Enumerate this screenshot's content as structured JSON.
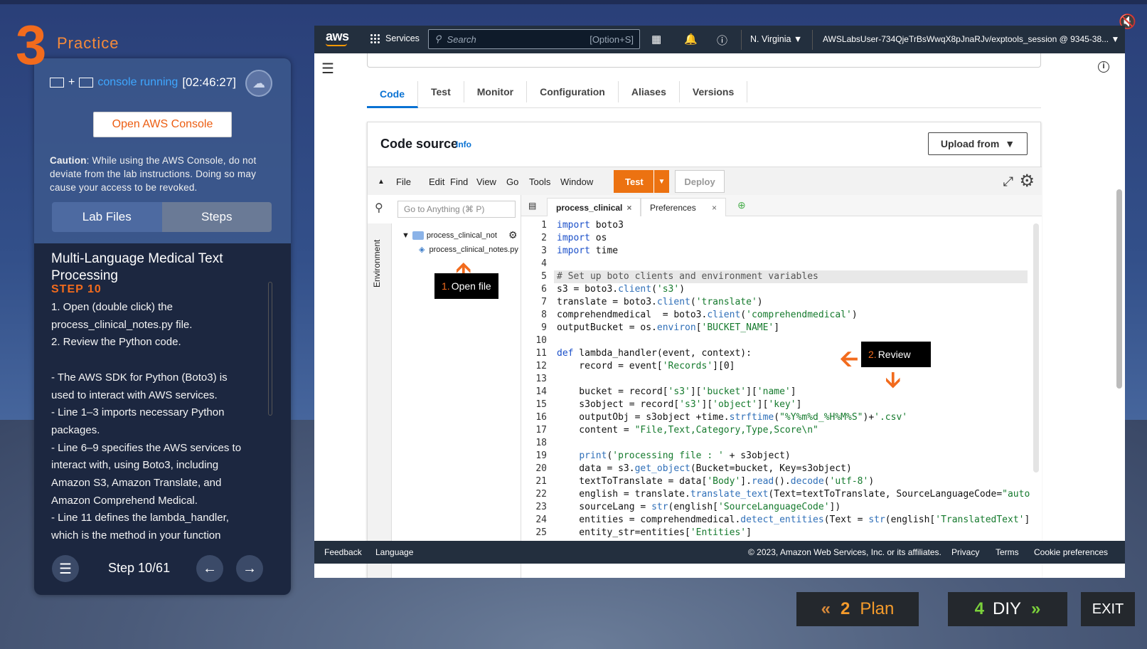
{
  "left": {
    "practice_number": "3",
    "practice_label": "Practice",
    "status_text": "console running",
    "timer": "[02:46:27]",
    "open_console": "Open AWS Console",
    "caution_label": "Caution",
    "caution_text": ": While using the AWS Console, do not deviate from the lab instructions. Doing so may cause your access to be revoked.",
    "tab_lab_files": "Lab Files",
    "tab_steps": "Steps",
    "title": "Multi-Language Medical Text Processing",
    "step_label": "STEP 10",
    "body_lines": [
      "1.  Open (double click) the",
      "process_clinical_notes.py file.",
      "2.  Review the Python code.",
      "",
      "- The AWS SDK for Python (Boto3) is",
      "used to interact with AWS services.",
      "- Line 1–3 imports necessary Python",
      "packages.",
      "- Line 6–9 specifies the AWS services to",
      "interact with, using Boto3, including",
      "Amazon S3, Amazon Translate, and",
      "Amazon Comprehend Medical.",
      "- Line 11 defines the lambda_handler,",
      "which is the method in your function"
    ],
    "step_counter": "Step 10/61"
  },
  "aws": {
    "logo": "aws",
    "services": "Services",
    "search_placeholder": "Search",
    "search_shortcut": "[Option+S]",
    "region": "N. Virginia ▼",
    "account": "AWSLabsUser-734QjeTrBsWwqX8pJnaRJv/exptools_session @ 9345-38... ▼",
    "tabs": [
      "Code",
      "Test",
      "Monitor",
      "Configuration",
      "Aliases",
      "Versions"
    ],
    "code_source": "Code source",
    "info": "Info",
    "upload_from": "Upload from",
    "menu": [
      "File",
      "Edit",
      "Find",
      "View",
      "Go",
      "Tools",
      "Window"
    ],
    "test": "Test",
    "deploy": "Deploy",
    "goto_placeholder": "Go to Anything (⌘ P)",
    "environment": "Environment",
    "folder": "process_clinical_not",
    "file": "process_clinical_notes.py",
    "editor_tab1": "process_clinical",
    "editor_tab2": "Preferences",
    "callout1_num": "1.",
    "callout1_text": " Open file",
    "callout2_num": "2.",
    "callout2_text": " Review",
    "footer_feedback": "Feedback",
    "footer_language": "Language",
    "footer_copy": "© 2023, Amazon Web Services, Inc. or its affiliates.",
    "footer_privacy": "Privacy",
    "footer_terms": "Terms",
    "footer_cookie": "Cookie preferences"
  },
  "code_lines": [
    "import boto3",
    "import os",
    "import time",
    "",
    "# Set up boto clients and environment variables",
    "s3 = boto3.client('s3')",
    "translate = boto3.client('translate')",
    "comprehendmedical  = boto3.client('comprehendmedical')",
    "outputBucket = os.environ['BUCKET_NAME']",
    "",
    "def lambda_handler(event, context):",
    "    record = event['Records'][0]",
    "",
    "    bucket = record['s3']['bucket']['name']",
    "    s3object = record['s3']['object']['key']",
    "    outputObj = s3object +time.strftime(\"%Y%m%d_%H%M%S\")+'.csv'",
    "    content = \"File,Text,Category,Type,Score\\n\"",
    "",
    "    print('processing file : ' + s3object)",
    "    data = s3.get_object(Bucket=bucket, Key=s3object)",
    "    textToTranslate = data['Body'].read().decode('utf-8')",
    "    english = translate.translate_text(Text=textToTranslate, SourceLanguageCode=\"auto\",",
    "    sourceLang = str(english['SourceLanguageCode'])",
    "    entities = comprehendmedical.detect_entities(Text = str(english['TranslatedText'])",
    "    entity_str=entities['Entities']"
  ],
  "bottom": {
    "plan_num": "2",
    "plan_label": "Plan",
    "diy_num": "4",
    "diy_label": "DIY",
    "exit": "EXIT"
  }
}
